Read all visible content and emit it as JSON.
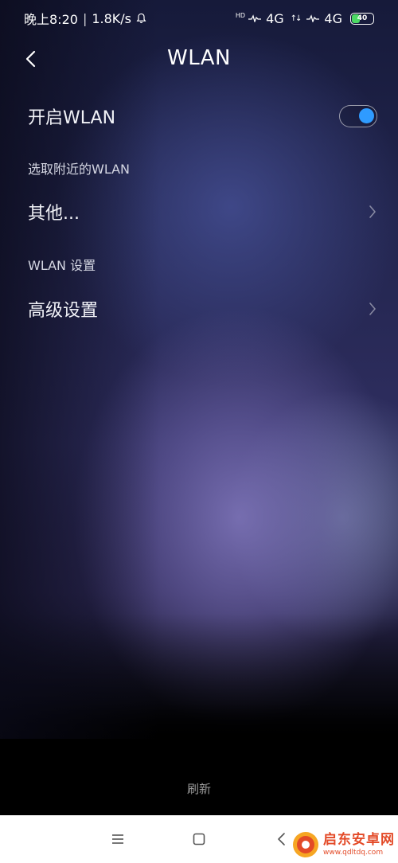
{
  "status_bar": {
    "time": "晚上8:20",
    "separator": "|",
    "speed": "1.8K/s",
    "hd": "HD",
    "network1": "4G",
    "network2": "4G",
    "battery": "40"
  },
  "header": {
    "title": "WLAN"
  },
  "wlan_toggle": {
    "label": "开启WLAN",
    "enabled": true
  },
  "nearby_section": {
    "label": "选取附近的WLAN"
  },
  "other_item": {
    "label": "其他..."
  },
  "settings_section": {
    "label": "WLAN 设置"
  },
  "advanced_item": {
    "label": "高级设置"
  },
  "bottom": {
    "refresh_label": "刷新"
  },
  "watermark": {
    "main": "启东安卓网",
    "sub": "www.qdltdq.com"
  },
  "colors": {
    "accent": "#2f9bff",
    "battery": "#4cd964",
    "watermark": "#e34a27"
  }
}
